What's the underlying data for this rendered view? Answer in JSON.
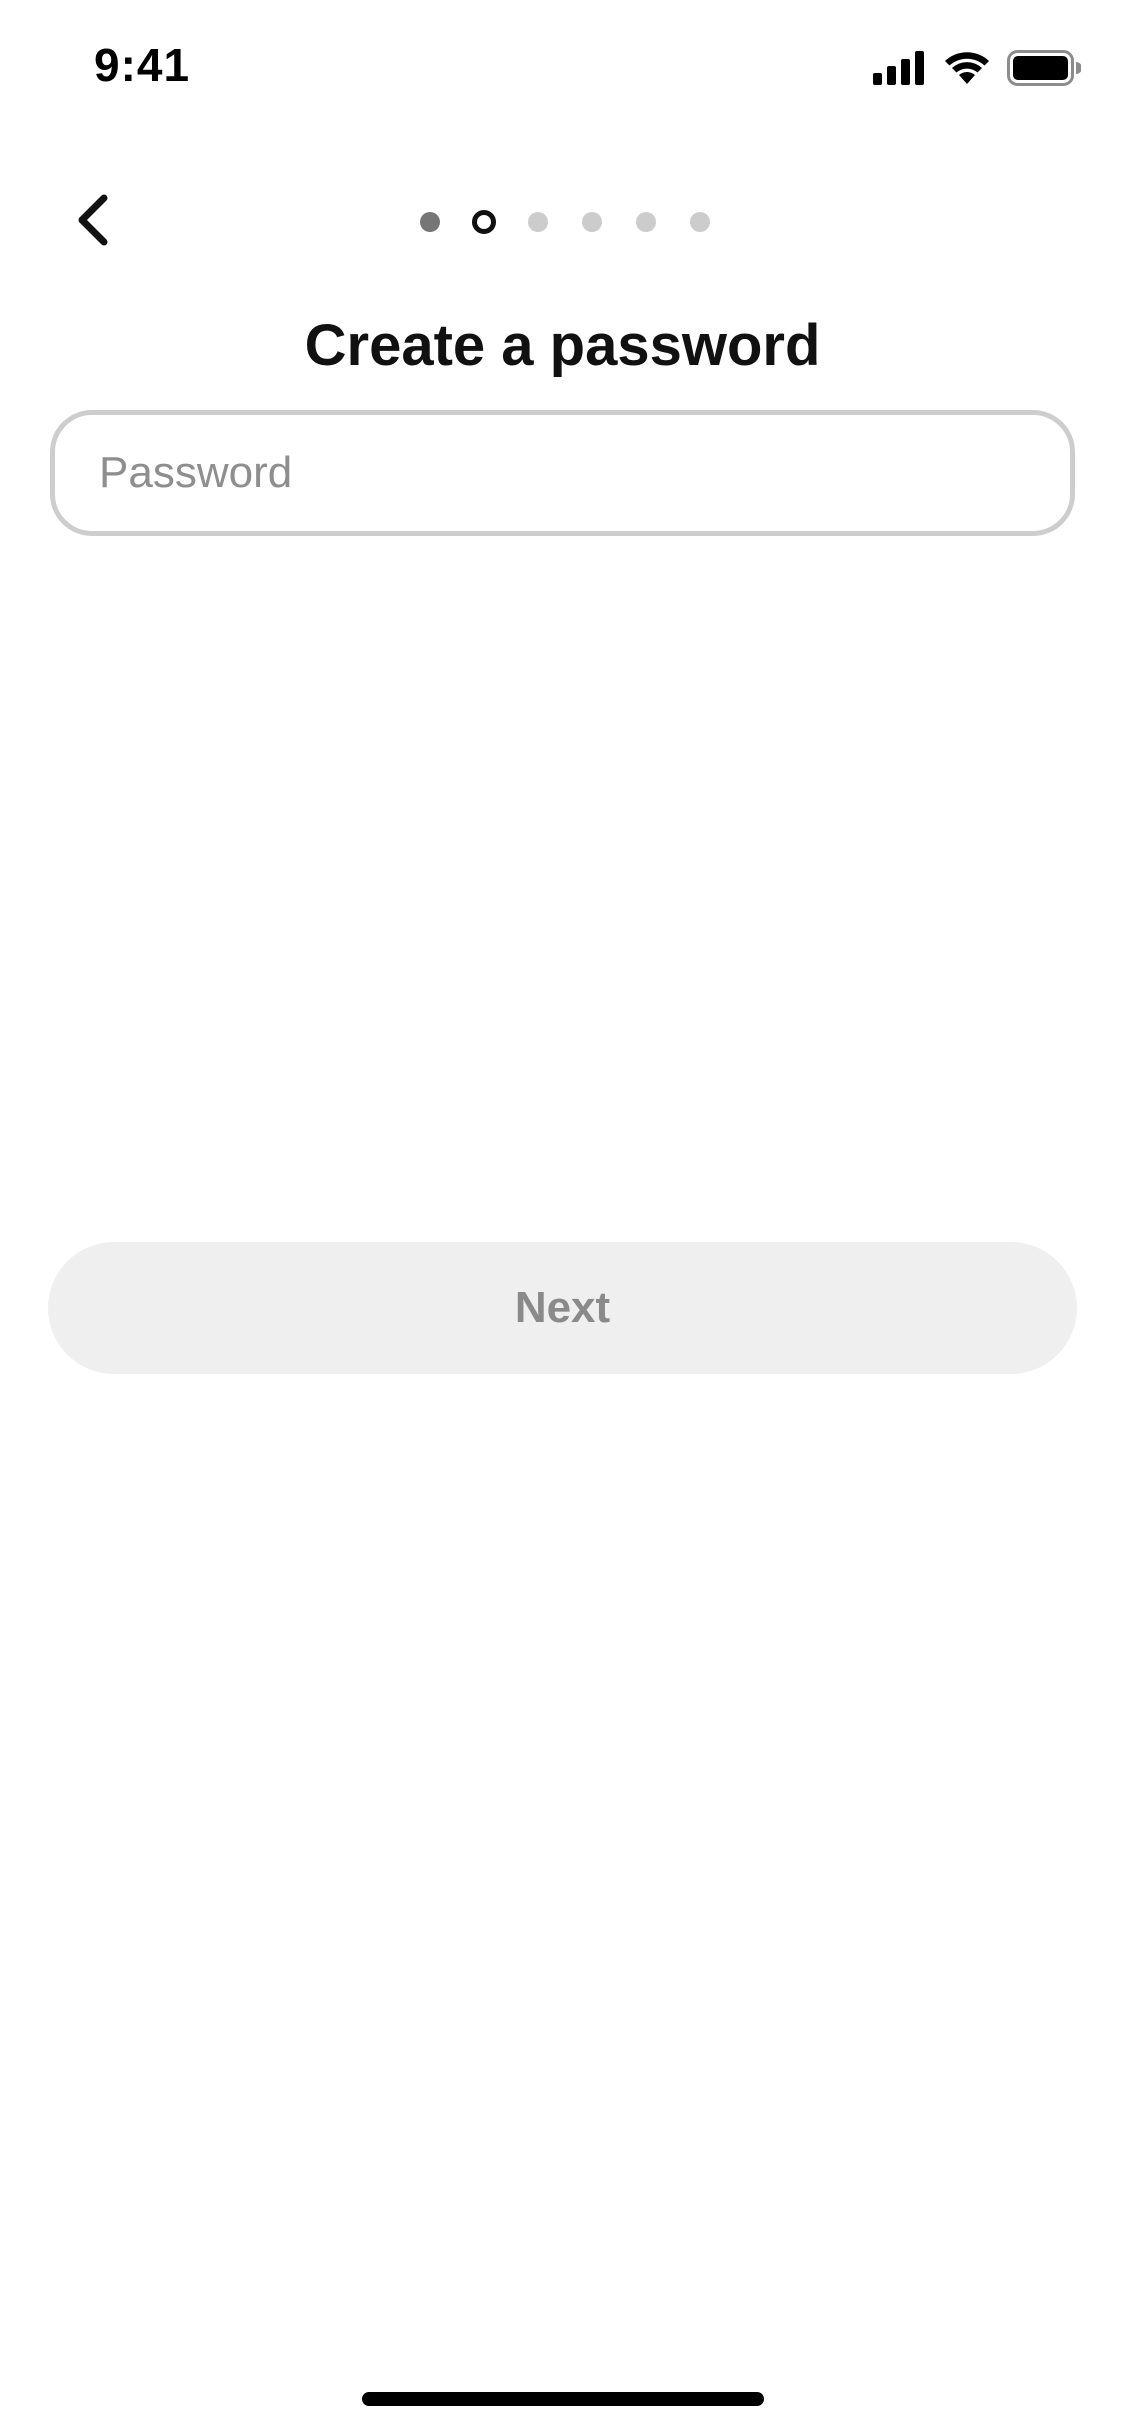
{
  "status_bar": {
    "time": "9:41",
    "icons": [
      "signal-icon",
      "wifi-icon",
      "battery-icon"
    ]
  },
  "header": {
    "back_icon": "chevron-left-icon",
    "progress": {
      "total_steps": 6,
      "current_step": 2
    }
  },
  "main": {
    "title": "Create a password",
    "password_field": {
      "placeholder": "Password",
      "value": ""
    },
    "next_button": {
      "label": "Next",
      "enabled": false
    }
  },
  "colors": {
    "text": "#111111",
    "placeholder": "#8e8e8e",
    "field_border": "#cdcdcd",
    "button_bg_disabled": "#efefef",
    "button_text_disabled": "#8a8a8a",
    "dot_completed": "#767676",
    "dot_current": "#111111",
    "dot_upcoming": "#cccccc"
  }
}
